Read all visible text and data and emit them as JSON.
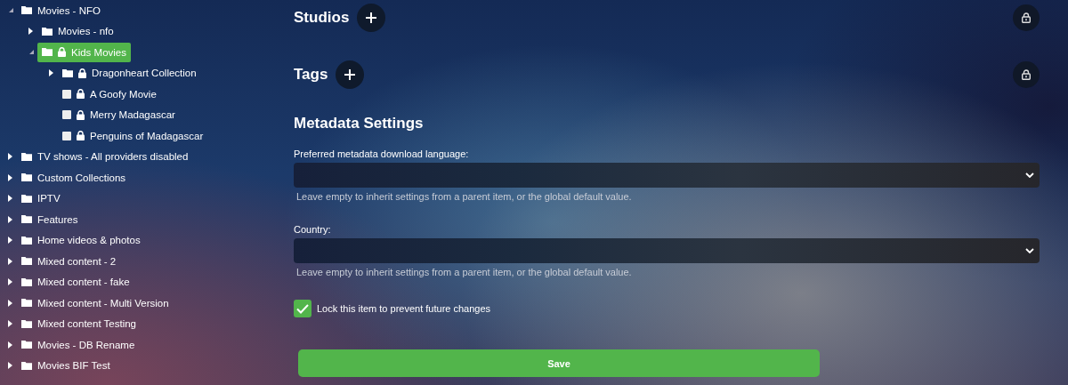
{
  "tree": [
    {
      "label": "Movies - NFO",
      "kind": "folder",
      "expanded": true,
      "locked": false,
      "selected": false,
      "children": [
        {
          "label": "Movies - nfo",
          "kind": "folder",
          "expanded": false,
          "locked": false,
          "selected": false
        },
        {
          "label": "Kids Movies",
          "kind": "folder",
          "expanded": true,
          "locked": true,
          "selected": true,
          "children": [
            {
              "label": "Dragonheart Collection",
              "kind": "folder",
              "expanded": false,
              "locked": true,
              "selected": false
            },
            {
              "label": "A Goofy Movie",
              "kind": "item",
              "locked": true,
              "selected": false
            },
            {
              "label": "Merry Madagascar",
              "kind": "item",
              "locked": true,
              "selected": false
            },
            {
              "label": "Penguins of Madagascar",
              "kind": "item",
              "locked": true,
              "selected": false
            }
          ]
        }
      ]
    },
    {
      "label": "TV shows - All providers disabled",
      "kind": "folder",
      "expanded": false,
      "locked": false,
      "selected": false
    },
    {
      "label": "Custom Collections",
      "kind": "folder",
      "expanded": false,
      "locked": false,
      "selected": false
    },
    {
      "label": "IPTV",
      "kind": "folder",
      "expanded": false,
      "locked": false,
      "selected": false
    },
    {
      "label": "Features",
      "kind": "folder",
      "expanded": false,
      "locked": false,
      "selected": false
    },
    {
      "label": "Home videos & photos",
      "kind": "folder",
      "expanded": false,
      "locked": false,
      "selected": false
    },
    {
      "label": "Mixed content - 2",
      "kind": "folder",
      "expanded": false,
      "locked": false,
      "selected": false
    },
    {
      "label": "Mixed content - fake",
      "kind": "folder",
      "expanded": false,
      "locked": false,
      "selected": false
    },
    {
      "label": "Mixed content - Multi Version",
      "kind": "folder",
      "expanded": false,
      "locked": false,
      "selected": false
    },
    {
      "label": "Mixed content Testing",
      "kind": "folder",
      "expanded": false,
      "locked": false,
      "selected": false
    },
    {
      "label": "Movies - DB Rename",
      "kind": "folder",
      "expanded": false,
      "locked": false,
      "selected": false
    },
    {
      "label": "Movies BIF Test",
      "kind": "folder",
      "expanded": false,
      "locked": false,
      "selected": false
    }
  ],
  "editor": {
    "list_sections": [
      {
        "title": "Studios"
      },
      {
        "title": "Tags"
      }
    ],
    "metadata_settings": {
      "title": "Metadata Settings",
      "fields": [
        {
          "label": "Preferred metadata download language:",
          "hint": "Leave empty to inherit settings from a parent item, or the global default value."
        },
        {
          "label": "Country:",
          "hint": "Leave empty to inherit settings from a parent item, or the global default value."
        }
      ]
    },
    "lock_checkbox": {
      "label": "Lock this item to prevent future changes",
      "checked": true
    },
    "save_button": "Save"
  }
}
